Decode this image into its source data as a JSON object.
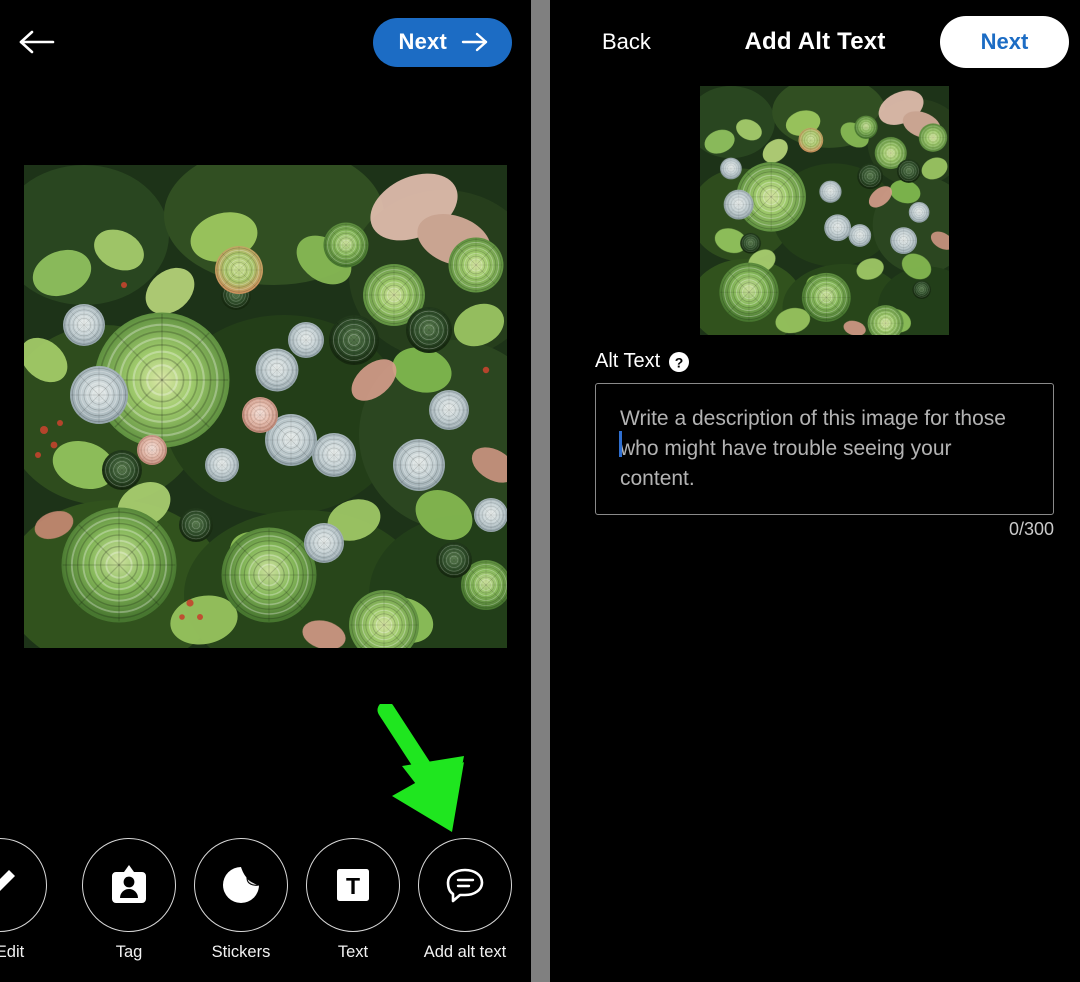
{
  "left_panel": {
    "back_icon": "arrow-left-icon",
    "next_button": {
      "label": "Next",
      "icon": "arrow-right-icon",
      "background_color": "#1c6cc4",
      "text_color": "#ffffff"
    },
    "photo": {
      "alt_description": "Overhead photo of a dense succulent garden with green, pale blue-grey and pink rosettes"
    },
    "toolbar": [
      {
        "label": "Edit",
        "icon": "pencil-icon",
        "name": "edit"
      },
      {
        "label": "Tag",
        "icon": "person-badge-icon",
        "name": "tag"
      },
      {
        "label": "Stickers",
        "icon": "sticker-peel-icon",
        "name": "stickers"
      },
      {
        "label": "Text",
        "icon": "text-t-icon",
        "name": "text"
      },
      {
        "label": "Add alt text",
        "icon": "speech-bubble-icon",
        "name": "add-alt-text"
      }
    ],
    "annotation": {
      "shape": "arrow-down-right",
      "color": "#1fe61f",
      "points_to": "Add alt text"
    }
  },
  "divider": {
    "color": "#808080"
  },
  "right_panel": {
    "back_label": "Back",
    "title": "Add Alt Text",
    "next_button": {
      "label": "Next",
      "background_color": "#ffffff",
      "text_color": "#1c6cc4"
    },
    "photo": {
      "alt_description": "Thumbnail of the succulent garden photo"
    },
    "alt_text_field": {
      "label": "Alt Text",
      "help_icon": "question-mark-circle-icon",
      "value": "",
      "placeholder": "Write a description of this image for those who might have trouble seeing your content.",
      "counter": "0/300",
      "max_length": 300,
      "caret_color": "#2f6fd0"
    }
  }
}
